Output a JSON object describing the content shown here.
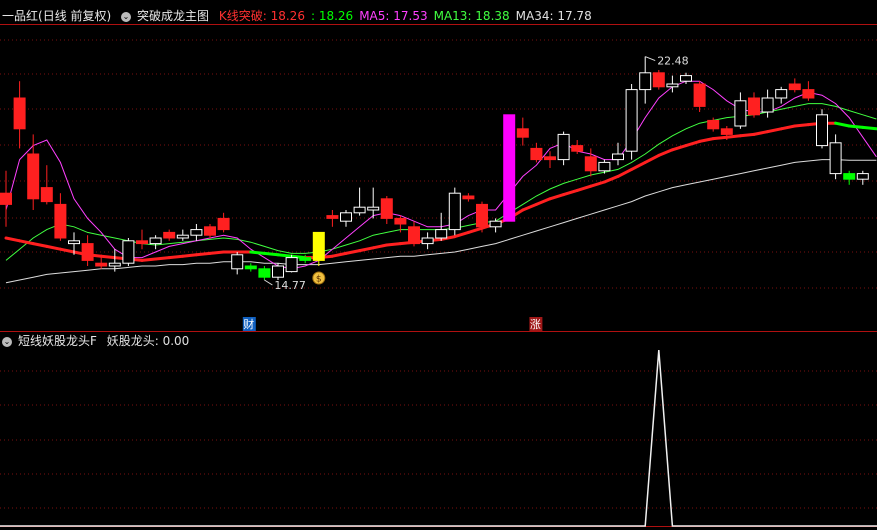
{
  "main_panel": {
    "stock_title": "一品红",
    "period_label": "(日线 前复权)",
    "indicator_name": "突破成龙主图",
    "indicators": [
      {
        "label": "K线突破:",
        "value": "18.26",
        "color": "#ff3030"
      },
      {
        "label": ":",
        "value": "18.26",
        "color": "#00ff00"
      },
      {
        "label": "MA5:",
        "value": "17.53",
        "color": "#ff40ff"
      },
      {
        "label": "MA13:",
        "value": "18.38",
        "color": "#40ff40"
      },
      {
        "label": "MA34:",
        "value": "17.78",
        "color": "#e0e0e0"
      }
    ],
    "high_label": "22.48",
    "low_label": "14.77",
    "marker_cai": "财",
    "marker_zhang": "涨",
    "coin_icon": "money-bag-icon"
  },
  "sub_panel": {
    "indicator_name": "短线妖股龙头F",
    "indicators": [
      {
        "label": "妖股龙头:",
        "value": "0.00",
        "color": "#e0e0e0"
      }
    ]
  },
  "colors": {
    "up": "#ff2020",
    "down": "#00ff00",
    "hollow": "#ffffff",
    "background": "#000000",
    "divider": "#b01010",
    "grid": "#7a1010"
  },
  "chart_data": {
    "type": "candlestick",
    "ylim": [
      13,
      23.5
    ],
    "candles": [
      {
        "o": 17.2,
        "h": 18.4,
        "l": 16.4,
        "c": 17.6,
        "k": "up"
      },
      {
        "o": 19.9,
        "h": 21.6,
        "l": 19.2,
        "c": 21.0,
        "k": "up"
      },
      {
        "o": 19.0,
        "h": 19.7,
        "l": 17.0,
        "c": 17.4,
        "k": "up"
      },
      {
        "o": 17.8,
        "h": 18.6,
        "l": 17.2,
        "c": 17.3,
        "k": "up"
      },
      {
        "o": 17.2,
        "h": 17.6,
        "l": 15.9,
        "c": 16.0,
        "k": "up"
      },
      {
        "o": 15.9,
        "h": 16.2,
        "l": 15.4,
        "c": 15.8,
        "k": "hollow"
      },
      {
        "o": 15.8,
        "h": 16.1,
        "l": 15.0,
        "c": 15.2,
        "k": "up"
      },
      {
        "o": 15.1,
        "h": 15.4,
        "l": 14.9,
        "c": 15.0,
        "k": "up"
      },
      {
        "o": 15.0,
        "h": 15.6,
        "l": 14.8,
        "c": 15.1,
        "k": "hollow"
      },
      {
        "o": 15.1,
        "h": 16.0,
        "l": 15.0,
        "c": 15.9,
        "k": "hollow"
      },
      {
        "o": 15.9,
        "h": 16.3,
        "l": 15.6,
        "c": 15.8,
        "k": "up"
      },
      {
        "o": 15.8,
        "h": 16.1,
        "l": 15.6,
        "c": 16.0,
        "k": "hollow"
      },
      {
        "o": 16.2,
        "h": 16.3,
        "l": 15.9,
        "c": 16.0,
        "k": "up"
      },
      {
        "o": 16.0,
        "h": 16.3,
        "l": 15.9,
        "c": 16.1,
        "k": "hollow"
      },
      {
        "o": 16.1,
        "h": 16.5,
        "l": 15.9,
        "c": 16.3,
        "k": "hollow"
      },
      {
        "o": 16.4,
        "h": 16.5,
        "l": 16.0,
        "c": 16.1,
        "k": "up"
      },
      {
        "o": 16.7,
        "h": 16.9,
        "l": 16.2,
        "c": 16.3,
        "k": "up"
      },
      {
        "o": 15.4,
        "h": 15.5,
        "l": 14.7,
        "c": 14.9,
        "k": "hollow"
      },
      {
        "o": 14.9,
        "h": 15.1,
        "l": 14.8,
        "c": 15.0,
        "k": "down"
      },
      {
        "o": 14.9,
        "h": 15.0,
        "l": 14.5,
        "c": 14.6,
        "k": "down"
      },
      {
        "o": 14.6,
        "h": 15.1,
        "l": 14.5,
        "c": 15.0,
        "k": "hollow"
      },
      {
        "o": 14.8,
        "h": 15.4,
        "l": 14.77,
        "c": 15.3,
        "k": "hollow"
      },
      {
        "o": 15.3,
        "h": 15.4,
        "l": 15.1,
        "c": 15.2,
        "k": "down"
      },
      {
        "o": 15.2,
        "h": 16.2,
        "l": 15.0,
        "c": 16.2,
        "k": "yellow"
      },
      {
        "o": 16.8,
        "h": 17.0,
        "l": 16.4,
        "c": 16.7,
        "k": "up"
      },
      {
        "o": 16.6,
        "h": 17.0,
        "l": 16.4,
        "c": 16.9,
        "k": "hollow"
      },
      {
        "o": 16.9,
        "h": 17.8,
        "l": 16.8,
        "c": 17.1,
        "k": "hollow"
      },
      {
        "o": 17.1,
        "h": 17.8,
        "l": 16.7,
        "c": 17.0,
        "k": "hollow"
      },
      {
        "o": 17.4,
        "h": 17.5,
        "l": 16.5,
        "c": 16.7,
        "k": "up"
      },
      {
        "o": 16.7,
        "h": 16.8,
        "l": 16.2,
        "c": 16.5,
        "k": "up"
      },
      {
        "o": 16.4,
        "h": 16.6,
        "l": 15.7,
        "c": 15.8,
        "k": "up"
      },
      {
        "o": 15.8,
        "h": 16.2,
        "l": 15.6,
        "c": 16.0,
        "k": "hollow"
      },
      {
        "o": 16.0,
        "h": 16.9,
        "l": 15.9,
        "c": 16.3,
        "k": "hollow"
      },
      {
        "o": 16.3,
        "h": 17.8,
        "l": 16.1,
        "c": 17.6,
        "k": "hollow"
      },
      {
        "o": 17.5,
        "h": 17.6,
        "l": 17.3,
        "c": 17.4,
        "k": "up"
      },
      {
        "o": 17.2,
        "h": 17.3,
        "l": 16.2,
        "c": 16.4,
        "k": "up"
      },
      {
        "o": 16.4,
        "h": 16.7,
        "l": 16.2,
        "c": 16.6,
        "k": "hollow"
      },
      {
        "o": 16.6,
        "h": 20.4,
        "l": 16.6,
        "c": 20.4,
        "k": "magenta"
      },
      {
        "o": 19.9,
        "h": 20.3,
        "l": 19.3,
        "c": 19.6,
        "k": "up"
      },
      {
        "o": 19.2,
        "h": 19.4,
        "l": 18.7,
        "c": 18.8,
        "k": "up"
      },
      {
        "o": 18.8,
        "h": 19.1,
        "l": 18.5,
        "c": 18.9,
        "k": "up"
      },
      {
        "o": 18.8,
        "h": 19.8,
        "l": 18.6,
        "c": 19.7,
        "k": "hollow"
      },
      {
        "o": 19.3,
        "h": 19.5,
        "l": 19.0,
        "c": 19.1,
        "k": "up"
      },
      {
        "o": 18.9,
        "h": 19.2,
        "l": 18.2,
        "c": 18.4,
        "k": "up"
      },
      {
        "o": 18.4,
        "h": 18.8,
        "l": 18.3,
        "c": 18.7,
        "k": "hollow"
      },
      {
        "o": 18.8,
        "h": 19.4,
        "l": 18.6,
        "c": 19.0,
        "k": "hollow"
      },
      {
        "o": 19.1,
        "h": 21.5,
        "l": 18.8,
        "c": 21.3,
        "k": "hollow"
      },
      {
        "o": 21.3,
        "h": 22.48,
        "l": 20.8,
        "c": 21.9,
        "k": "hollow"
      },
      {
        "o": 21.9,
        "h": 22.0,
        "l": 21.3,
        "c": 21.4,
        "k": "up"
      },
      {
        "o": 21.4,
        "h": 21.8,
        "l": 21.2,
        "c": 21.5,
        "k": "hollow"
      },
      {
        "o": 21.8,
        "h": 21.9,
        "l": 21.5,
        "c": 21.6,
        "k": "hollow"
      },
      {
        "o": 21.5,
        "h": 21.6,
        "l": 20.5,
        "c": 20.7,
        "k": "up"
      },
      {
        "o": 20.2,
        "h": 20.3,
        "l": 19.8,
        "c": 19.9,
        "k": "up"
      },
      {
        "o": 19.7,
        "h": 20.0,
        "l": 19.5,
        "c": 19.9,
        "k": "up"
      },
      {
        "o": 20.0,
        "h": 21.2,
        "l": 19.9,
        "c": 20.9,
        "k": "hollow"
      },
      {
        "o": 20.4,
        "h": 21.2,
        "l": 20.3,
        "c": 21.0,
        "k": "up"
      },
      {
        "o": 20.5,
        "h": 21.3,
        "l": 20.3,
        "c": 21.0,
        "k": "hollow"
      },
      {
        "o": 21.0,
        "h": 21.4,
        "l": 20.8,
        "c": 21.3,
        "k": "hollow"
      },
      {
        "o": 21.5,
        "h": 21.7,
        "l": 21.2,
        "c": 21.3,
        "k": "up"
      },
      {
        "o": 21.3,
        "h": 21.6,
        "l": 20.9,
        "c": 21.0,
        "k": "up"
      },
      {
        "o": 20.4,
        "h": 20.6,
        "l": 19.2,
        "c": 19.3,
        "k": "hollow"
      },
      {
        "o": 19.4,
        "h": 19.7,
        "l": 18.1,
        "c": 18.3,
        "k": "hollow"
      },
      {
        "o": 18.3,
        "h": 18.4,
        "l": 17.9,
        "c": 18.1,
        "k": "down"
      },
      {
        "o": 18.1,
        "h": 18.4,
        "l": 17.9,
        "c": 18.3,
        "k": "hollow"
      }
    ],
    "line_k_breakout": [
      16.0,
      15.9,
      15.8,
      15.7,
      15.6,
      15.5,
      15.4,
      15.35,
      15.3,
      15.25,
      15.2,
      15.25,
      15.3,
      15.35,
      15.4,
      15.45,
      15.5,
      15.5,
      15.5,
      15.45,
      15.4,
      15.35,
      15.3,
      15.3,
      15.35,
      15.45,
      15.55,
      15.65,
      15.75,
      15.8,
      15.85,
      15.9,
      15.95,
      16.05,
      16.2,
      16.35,
      16.5,
      16.7,
      17.0,
      17.2,
      17.4,
      17.55,
      17.7,
      17.85,
      18.0,
      18.2,
      18.45,
      18.7,
      18.95,
      19.15,
      19.3,
      19.45,
      19.55,
      19.6,
      19.65,
      19.7,
      19.8,
      19.9,
      20.0,
      20.05,
      20.1,
      20.1,
      20.0,
      19.95,
      19.9
    ],
    "line_ma5": [
      17.0,
      18.8,
      19.3,
      19.5,
      18.7,
      17.4,
      16.7,
      16.2,
      15.6,
      15.3,
      15.3,
      15.5,
      15.7,
      15.8,
      15.9,
      16.0,
      16.1,
      16.0,
      15.6,
      15.3,
      15.0,
      14.9,
      15.0,
      15.2,
      15.6,
      16.0,
      16.4,
      16.8,
      16.9,
      16.8,
      16.6,
      16.4,
      16.4,
      16.5,
      16.8,
      17.0,
      17.0,
      17.6,
      18.2,
      18.6,
      19.2,
      19.4,
      19.1,
      19.0,
      18.8,
      18.8,
      19.5,
      20.3,
      21.0,
      21.4,
      21.6,
      21.6,
      21.3,
      20.9,
      20.6,
      20.5,
      20.5,
      20.7,
      21.0,
      21.2,
      21.1,
      20.8,
      20.3,
      19.6,
      18.9
    ],
    "line_ma13": [
      15.2,
      15.6,
      16.0,
      16.3,
      16.5,
      16.4,
      16.2,
      16.1,
      16.0,
      15.9,
      15.8,
      15.75,
      15.8,
      15.85,
      15.9,
      15.95,
      16.0,
      15.95,
      15.85,
      15.7,
      15.55,
      15.45,
      15.45,
      15.5,
      15.6,
      15.75,
      15.9,
      16.1,
      16.2,
      16.3,
      16.3,
      16.3,
      16.3,
      16.35,
      16.45,
      16.55,
      16.6,
      16.9,
      17.2,
      17.5,
      17.75,
      17.95,
      18.1,
      18.25,
      18.35,
      18.45,
      18.7,
      19.0,
      19.35,
      19.65,
      19.9,
      20.1,
      20.2,
      20.3,
      20.35,
      20.4,
      20.5,
      20.6,
      20.7,
      20.8,
      20.8,
      20.7,
      20.55,
      20.4,
      20.25
    ],
    "line_ma34": [
      14.4,
      14.5,
      14.6,
      14.7,
      14.75,
      14.8,
      14.85,
      14.9,
      14.9,
      14.95,
      15.0,
      15.0,
      15.05,
      15.05,
      15.1,
      15.1,
      15.15,
      15.15,
      15.15,
      15.1,
      15.1,
      15.05,
      15.05,
      15.05,
      15.1,
      15.15,
      15.2,
      15.25,
      15.3,
      15.35,
      15.35,
      15.4,
      15.45,
      15.5,
      15.6,
      15.7,
      15.8,
      15.95,
      16.1,
      16.25,
      16.4,
      16.55,
      16.7,
      16.85,
      17.0,
      17.15,
      17.3,
      17.5,
      17.65,
      17.8,
      17.9,
      18.0,
      18.1,
      18.2,
      18.3,
      18.4,
      18.5,
      18.6,
      18.7,
      18.75,
      18.8,
      18.8,
      18.78,
      18.78,
      18.78
    ],
    "sub_series": [
      0,
      0,
      0,
      0,
      0,
      0,
      0,
      0,
      0,
      0,
      0,
      0,
      0,
      0,
      0,
      0,
      0,
      0,
      0,
      0,
      0,
      0,
      0,
      0,
      0,
      0,
      0,
      0,
      0,
      0,
      0,
      0,
      0,
      0,
      0,
      0,
      0,
      0,
      0,
      0,
      0,
      0,
      0,
      0,
      0,
      0,
      0,
      0,
      0,
      0,
      0,
      0,
      0,
      0,
      0,
      0,
      0,
      0,
      0,
      0,
      0,
      0,
      0,
      0,
      0
    ],
    "sub_spike_index": 48,
    "sub_ylim": [
      0,
      1
    ]
  }
}
